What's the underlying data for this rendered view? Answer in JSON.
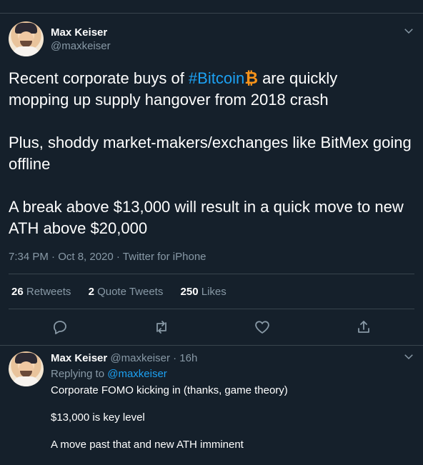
{
  "tweet": {
    "author_name": "Max Keiser",
    "author_handle": "@maxkeiser",
    "text_pre": "Recent corporate buys of ",
    "hashtag": "#Bitcoin",
    "text_post_line1": " are quickly",
    "text_line2": "mopping up supply hangover from 2018 crash",
    "paragraph2": "Plus, shoddy market-makers/exchanges like BitMex going offline",
    "paragraph3": "A break above $13,000 will result in a quick move to new ATH above $20,000",
    "btc_glyph": "₿",
    "meta": "7:34 PM · Oct 8, 2020 · Twitter for iPhone",
    "stats": {
      "retweets_count": "26",
      "retweets_label": " Retweets",
      "quotes_count": "2",
      "quotes_label": " Quote Tweets",
      "likes_count": "250",
      "likes_label": " Likes"
    }
  },
  "reply": {
    "author_name": "Max Keiser",
    "author_meta": " @maxkeiser · 16h",
    "replying_to_label": "Replying to ",
    "replying_to_handle": "@maxkeiser",
    "line1": "Corporate FOMO kicking in (thanks, game theory)",
    "line2": "$13,000 is key level",
    "line3": "A move past that and new ATH imminent"
  },
  "colors": {
    "background": "#15202b",
    "accent": "#1da1f2",
    "secondary_text": "#8899a6",
    "bitcoin": "#f7931a"
  },
  "icons": [
    "chevron-down-icon",
    "reply-icon",
    "retweet-icon",
    "like-icon",
    "share-icon"
  ]
}
